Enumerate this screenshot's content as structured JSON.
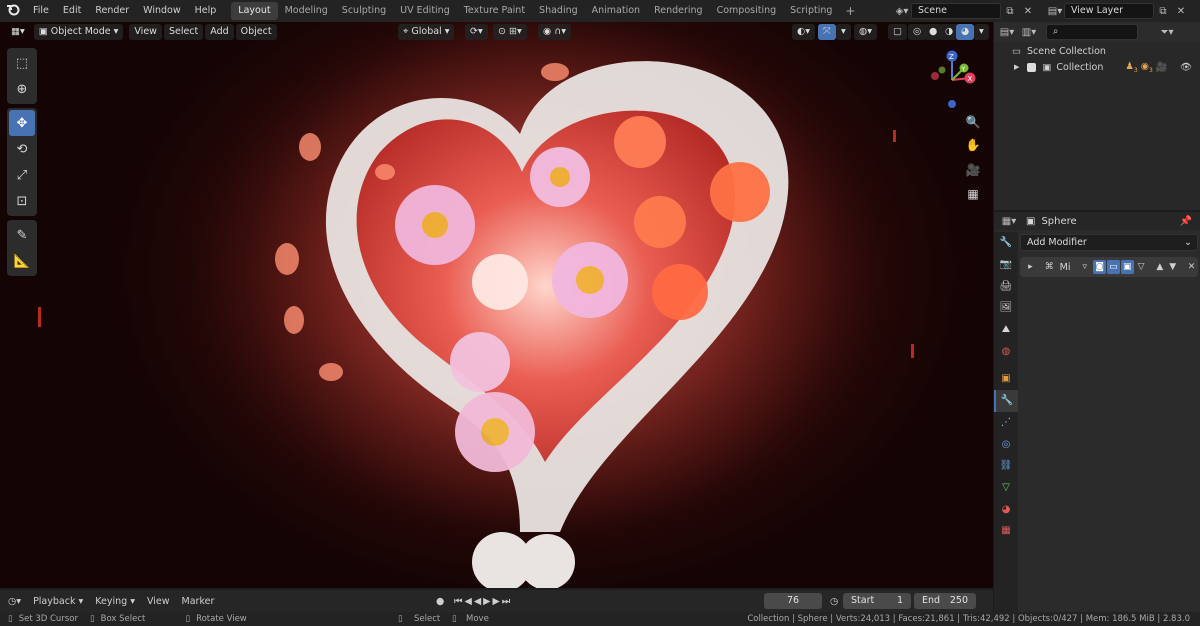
{
  "app": {
    "logo_icon": "blender-logo-icon"
  },
  "menu": [
    "File",
    "Edit",
    "Render",
    "Window",
    "Help"
  ],
  "workspaces": {
    "tabs": [
      "Layout",
      "Modeling",
      "Sculpting",
      "UV Editing",
      "Texture Paint",
      "Shading",
      "Animation",
      "Rendering",
      "Compositing",
      "Scripting"
    ],
    "active": "Layout",
    "add_label": "+"
  },
  "scene": {
    "name": "Scene",
    "view_layer": "View Layer"
  },
  "viewport": {
    "mode": "Object Mode",
    "menus": [
      "View",
      "Select",
      "Add",
      "Object"
    ],
    "orientation": "Global",
    "gizmo": {
      "z": "Z",
      "y": "Y",
      "x": "X"
    }
  },
  "toolbar": [
    "select-box-icon",
    "cursor-icon",
    "move-icon",
    "rotate-icon",
    "scale-icon",
    "transform-icon",
    "annotate-icon",
    "measure-icon"
  ],
  "outliner": {
    "root": "Scene Collection",
    "collection": "Collection",
    "badges": [
      "3",
      "3"
    ]
  },
  "properties": {
    "object_name": "Sphere",
    "add_modifier": "Add Modifier",
    "modifier_name": "Mi"
  },
  "timeline": {
    "menus": [
      "Playback",
      "Keying",
      "View",
      "Marker"
    ],
    "current_frame": "76",
    "start_label": "Start",
    "start": "1",
    "end_label": "End",
    "end": "250"
  },
  "status": {
    "left": [
      "Set 3D Cursor",
      "Box Select",
      "Rotate View"
    ],
    "mid": [
      "Select",
      "Move"
    ],
    "stats": "Collection | Sphere | Verts:24,013 | Faces:21,861 | Tris:42,492 | Objects:0/427 | Mem: 186.5 MiB | 2.83.0"
  },
  "colors": {
    "accent": "#4772b3",
    "scene_red": "#b84238",
    "heart": "#e9e4e2"
  }
}
